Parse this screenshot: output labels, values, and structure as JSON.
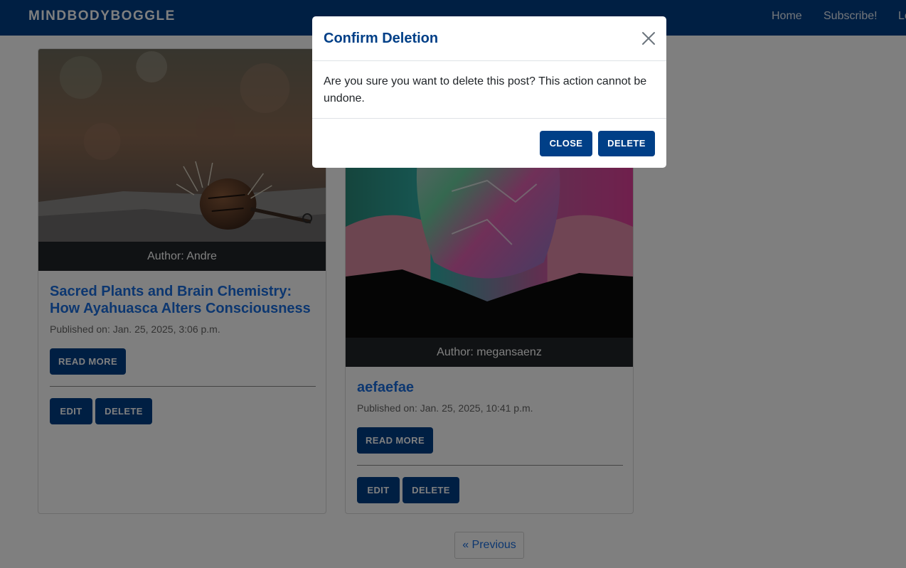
{
  "navbar": {
    "brand": "MINDBODYBOGGLE",
    "links": [
      {
        "label": "Home"
      },
      {
        "label": "Subscribe!"
      },
      {
        "label": "Lo"
      }
    ]
  },
  "posts": [
    {
      "author": "Author: Andre",
      "title": "Sacred Plants and Brain Chemistry: How Ayahuasca Alters Consciousness",
      "published": "Published on: Jan. 25, 2025, 3:06 p.m.",
      "read_more": "READ MORE",
      "edit": "EDIT",
      "delete": "DELETE"
    },
    {
      "author": "Author: megansaenz",
      "title": "aefaefae",
      "published": "Published on: Jan. 25, 2025, 10:41 p.m.",
      "read_more": "READ MORE",
      "edit": "EDIT",
      "delete": "DELETE"
    }
  ],
  "pagination": {
    "previous": "« Previous"
  },
  "modal": {
    "title": "Confirm Deletion",
    "body": "Are you sure you want to delete this post? This action cannot be undone.",
    "close_button": "CLOSE",
    "delete_button": "DELETE",
    "close_icon": "close-icon"
  },
  "colors": {
    "brand_navy": "#003f87",
    "link_blue": "#1a6fe0",
    "author_bar": "#212529"
  }
}
